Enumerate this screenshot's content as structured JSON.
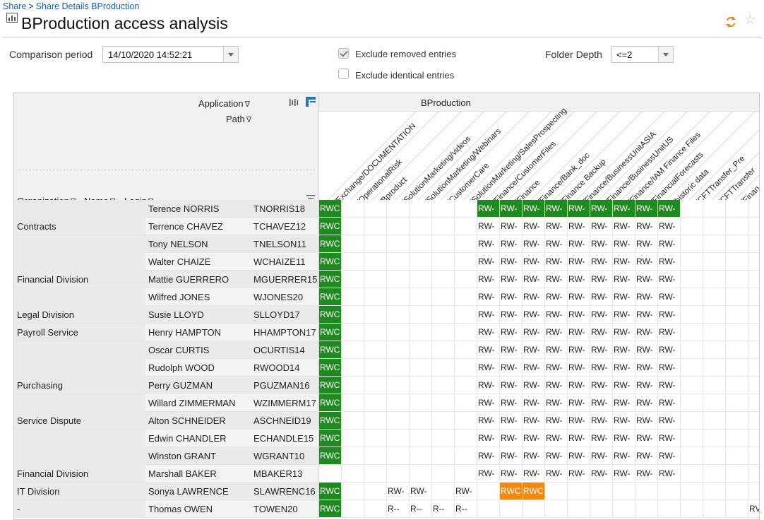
{
  "breadcrumb": {
    "root": "Share",
    "separator": ">",
    "current": "Share Details BProduction"
  },
  "title": "BProduction access analysis",
  "toolbar": {
    "refresh_icon": "refresh-icon",
    "favorite_icon": "star-icon"
  },
  "filters": {
    "comparison_label": "Comparison period",
    "comparison_value": "14/10/2020 14:52:21",
    "exclude_removed_label": "Exclude removed entries",
    "exclude_removed_checked": true,
    "exclude_identical_label": "Exclude identical entries",
    "exclude_identical_checked": false,
    "folder_depth_label": "Folder Depth",
    "folder_depth_value": "<=2"
  },
  "grid": {
    "header": {
      "application_label": "Application",
      "path_label": "Path",
      "organization_label": "Organization",
      "name_label": "Name",
      "login_label": "Login",
      "application_name": "BProduction",
      "columns": [
        "/Exchange/DOCUMENTATION",
        "/OperationalRisk",
        "/Bproduct",
        "/SolutionMarketing/videos",
        "/SolutionMarketing/Webinars",
        "/CustomerCare",
        "/SolutionMarketing/SalesProspecting",
        "/Finance/CustomerFiles",
        "/Finance",
        "/Finance/Bank_doc",
        "/Finance Backup",
        "/Finance/BusinessUnitASIA",
        "/Finance/BusinessUnitUS",
        "/Finance/IAM Finance Files",
        "/FinancialForecasts",
        "/historic data",
        "/CFTTransfer_Pre",
        "/CFTTransfer",
        "/Finan"
      ]
    },
    "rows": [
      {
        "org": "",
        "name": "Terence NORRIS",
        "login": "TNORRIS18",
        "access": [
          "RWC",
          "",
          "",
          "",
          "",
          "",
          "",
          "RW-",
          "RW-",
          "RW-",
          "RW-",
          "RW-",
          "RW-",
          "RW-",
          "RW-",
          "RW-",
          "",
          "",
          "",
          ""
        ],
        "style": [
          "green",
          "",
          "",
          "",
          "",
          "",
          "",
          "green",
          "green",
          "green",
          "green",
          "green",
          "green",
          "green",
          "green",
          "green",
          "",
          "",
          "",
          ""
        ]
      },
      {
        "org": "Contracts",
        "name": "Terrence CHAVEZ",
        "login": "TCHAVEZ12",
        "access": [
          "RWC",
          "",
          "",
          "",
          "",
          "",
          "",
          "RW-",
          "RW-",
          "RW-",
          "RW-",
          "RW-",
          "RW-",
          "RW-",
          "RW-",
          "RW-",
          "",
          "",
          "",
          ""
        ],
        "style": [
          "green"
        ]
      },
      {
        "org": "",
        "name": "Tony NELSON",
        "login": "TNELSON11",
        "access": [
          "RWC",
          "",
          "",
          "",
          "",
          "",
          "",
          "RW-",
          "RW-",
          "RW-",
          "RW-",
          "RW-",
          "RW-",
          "RW-",
          "RW-",
          "RW-",
          "",
          "",
          "",
          ""
        ],
        "style": [
          "green"
        ]
      },
      {
        "org": "",
        "name": "Walter CHAIZE",
        "login": "WCHAIZE11",
        "access": [
          "RWC",
          "",
          "",
          "",
          "",
          "",
          "",
          "RW-",
          "RW-",
          "RW-",
          "RW-",
          "RW-",
          "RW-",
          "RW-",
          "RW-",
          "RW-",
          "",
          "",
          "",
          ""
        ],
        "style": [
          "green"
        ]
      },
      {
        "org": "Financial Division",
        "name": "Mattie GUERRERO",
        "login": "MGUERRER15",
        "access": [
          "RWC",
          "",
          "",
          "",
          "",
          "",
          "",
          "RW-",
          "RW-",
          "RW-",
          "RW-",
          "RW-",
          "RW-",
          "RW-",
          "RW-",
          "RW-",
          "",
          "",
          "",
          ""
        ],
        "style": [
          "green"
        ]
      },
      {
        "org": "",
        "name": "Wilfred JONES",
        "login": "WJONES20",
        "access": [
          "RWC",
          "",
          "",
          "",
          "",
          "",
          "",
          "RW-",
          "RW-",
          "RW-",
          "RW-",
          "RW-",
          "RW-",
          "RW-",
          "RW-",
          "RW-",
          "",
          "",
          "",
          ""
        ],
        "style": [
          "green"
        ]
      },
      {
        "org": "Legal Division",
        "name": "Susie LLOYD",
        "login": "SLLOYD17",
        "access": [
          "RWC",
          "",
          "",
          "",
          "",
          "",
          "",
          "RW-",
          "RW-",
          "RW-",
          "RW-",
          "RW-",
          "RW-",
          "RW-",
          "RW-",
          "RW-",
          "",
          "",
          "",
          ""
        ],
        "style": [
          "green"
        ]
      },
      {
        "org": "Payroll Service",
        "name": "Henry HAMPTON",
        "login": "HHAMPTON17",
        "access": [
          "RWC",
          "",
          "",
          "",
          "",
          "",
          "",
          "RW-",
          "RW-",
          "RW-",
          "RW-",
          "RW-",
          "RW-",
          "RW-",
          "RW-",
          "RW-",
          "",
          "",
          "",
          ""
        ],
        "style": [
          "green"
        ]
      },
      {
        "org": "",
        "name": "Oscar CURTIS",
        "login": "OCURTIS14",
        "access": [
          "RWC",
          "",
          "",
          "",
          "",
          "",
          "",
          "RW-",
          "RW-",
          "RW-",
          "RW-",
          "RW-",
          "RW-",
          "RW-",
          "RW-",
          "RW-",
          "",
          "",
          "",
          ""
        ],
        "style": [
          "green"
        ]
      },
      {
        "org": "",
        "name": "Rudolph WOOD",
        "login": "RWOOD14",
        "access": [
          "RWC",
          "",
          "",
          "",
          "",
          "",
          "",
          "RW-",
          "RW-",
          "RW-",
          "RW-",
          "RW-",
          "RW-",
          "RW-",
          "RW-",
          "RW-",
          "",
          "",
          "",
          ""
        ],
        "style": [
          "green"
        ]
      },
      {
        "org": "Purchasing",
        "name": "Perry GUZMAN",
        "login": "PGUZMAN16",
        "access": [
          "RWC",
          "",
          "",
          "",
          "",
          "",
          "",
          "RW-",
          "RW-",
          "RW-",
          "RW-",
          "RW-",
          "RW-",
          "RW-",
          "RW-",
          "RW-",
          "",
          "",
          "",
          ""
        ],
        "style": [
          "green"
        ]
      },
      {
        "org": "",
        "name": "Willard ZIMMERMAN",
        "login": "WZIMMERM17",
        "access": [
          "RWC",
          "",
          "",
          "",
          "",
          "",
          "",
          "RW-",
          "RW-",
          "RW-",
          "RW-",
          "RW-",
          "RW-",
          "RW-",
          "RW-",
          "RW-",
          "",
          "",
          "",
          ""
        ],
        "style": [
          "green"
        ]
      },
      {
        "org": "Service Dispute",
        "name": "Alton SCHNEIDER",
        "login": "ASCHNEID19",
        "access": [
          "RWC",
          "",
          "",
          "",
          "",
          "",
          "",
          "RW-",
          "RW-",
          "RW-",
          "RW-",
          "RW-",
          "RW-",
          "RW-",
          "RW-",
          "RW-",
          "",
          "",
          "",
          ""
        ],
        "style": [
          "green"
        ]
      },
      {
        "org": "",
        "name": "Edwin CHANDLER",
        "login": "ECHANDLE15",
        "access": [
          "RWC",
          "",
          "",
          "",
          "",
          "",
          "",
          "RW-",
          "RW-",
          "RW-",
          "RW-",
          "RW-",
          "RW-",
          "RW-",
          "RW-",
          "RW-",
          "",
          "",
          "",
          ""
        ],
        "style": [
          "green"
        ]
      },
      {
        "org": "",
        "name": "Winston GRANT",
        "login": "WGRANT10",
        "access": [
          "RWC",
          "",
          "",
          "",
          "",
          "",
          "",
          "RW-",
          "RW-",
          "RW-",
          "RW-",
          "RW-",
          "RW-",
          "RW-",
          "RW-",
          "RW-",
          "",
          "",
          "",
          ""
        ],
        "style": [
          "green"
        ]
      },
      {
        "org": "Financial Division",
        "name": "Marshall BAKER",
        "login": "MBAKER13",
        "access": [
          "",
          "",
          "",
          "",
          "",
          "",
          "",
          "RW-",
          "RW-",
          "RW-",
          "RW-",
          "RW-",
          "RW-",
          "RW-",
          "RW-",
          "RW-",
          "",
          "",
          "",
          ""
        ],
        "style": []
      },
      {
        "org": "IT Division",
        "name": "Sonya LAWRENCE",
        "login": "SLAWRENC16",
        "access": [
          "RWC",
          "",
          "",
          "RW-",
          "RW-",
          "",
          "RW-",
          "",
          "RWC",
          "RWC",
          "",
          "",
          "",
          "",
          "",
          "",
          "",
          "",
          "",
          ""
        ],
        "style": [
          "green",
          "",
          "",
          "",
          "",
          "",
          "",
          "",
          "orange",
          "orange"
        ]
      },
      {
        "org": "-",
        "name": "Thomas OWEN",
        "login": "TOWEN20",
        "access": [
          "RWC",
          "",
          "",
          "R--",
          "R--",
          "R--",
          "R--",
          "",
          "",
          "",
          "",
          "",
          "",
          "",
          "",
          "",
          "",
          "",
          "",
          "RV"
        ],
        "style": [
          "green"
        ]
      }
    ]
  },
  "colors": {
    "granted": "#1f8a1f",
    "changed": "#f5890f",
    "link": "#1a5fa8"
  }
}
